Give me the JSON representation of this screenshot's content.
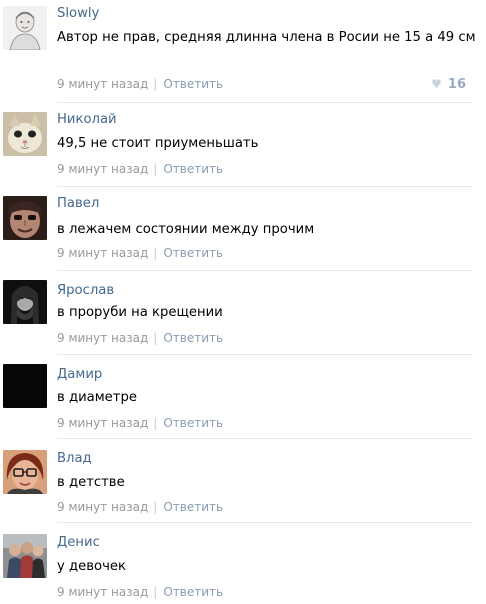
{
  "comments": [
    {
      "author": "Slowly",
      "text": "Автор не прав, средняя длинна члена в Росии не 15 а 49 см",
      "time": "9 минут назад",
      "reply": "Ответить",
      "likes": "16",
      "avatar": "sketch-face-avatar"
    },
    {
      "author": "Николай",
      "text": "49,5 не стоит приуменьшать",
      "time": "9 минут назад",
      "reply": "Ответить",
      "avatar": "cat-avatar"
    },
    {
      "author": "Павел",
      "text": "в лежачем состоянии между прочим",
      "time": "9 минут назад",
      "reply": "Ответить",
      "avatar": "painted-face-avatar"
    },
    {
      "author": "Ярослав",
      "text": "в проруби на крещении",
      "time": "9 минут назад",
      "reply": "Ответить",
      "avatar": "bearded-man-avatar"
    },
    {
      "author": "Дамир",
      "text": "в диаметре",
      "time": "9 минут назад",
      "reply": "Ответить",
      "avatar": "black-avatar"
    },
    {
      "author": "Влад",
      "text": "в детстве",
      "time": "9 минут назад",
      "reply": "Ответить",
      "avatar": "glasses-woman-avatar"
    },
    {
      "author": "Денис",
      "text": "у девочек",
      "time": "9 минут назад",
      "reply": "Ответить",
      "avatar": "group-photo-avatar"
    }
  ],
  "colors": {
    "author": "#45688e",
    "meta": "#999999",
    "reply": "#8a9db3",
    "divider": "#e6e9ee"
  }
}
